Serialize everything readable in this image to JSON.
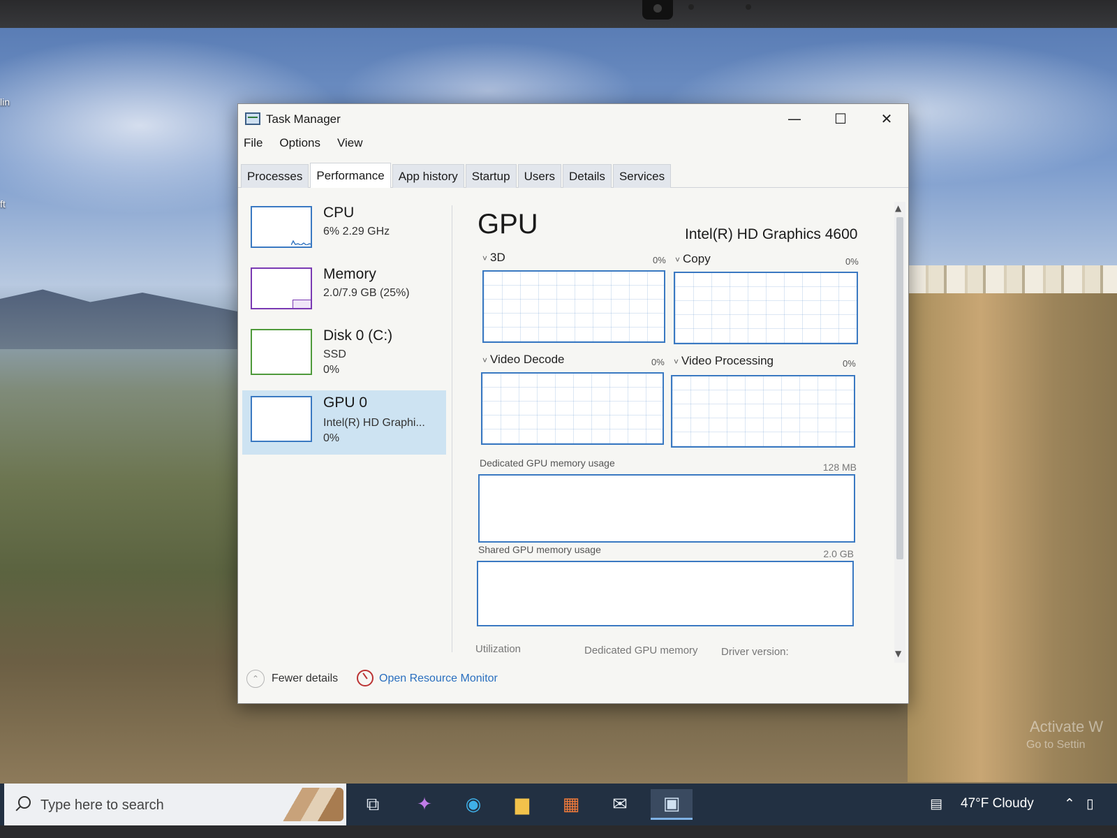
{
  "window": {
    "title": "Task Manager",
    "controls": {
      "minimize": "—",
      "maximize": "☐",
      "close": "✕"
    }
  },
  "menu": [
    "File",
    "Options",
    "View"
  ],
  "tabs": [
    "Processes",
    "Performance",
    "App history",
    "Startup",
    "Users",
    "Details",
    "Services"
  ],
  "active_tab": "Performance",
  "sidebar": [
    {
      "title": "CPU",
      "line1": "6% 2.29 GHz",
      "line2": ""
    },
    {
      "title": "Memory",
      "line1": "2.0/7.9 GB (25%)",
      "line2": ""
    },
    {
      "title": "Disk 0 (C:)",
      "line1": "SSD",
      "line2": "0%"
    },
    {
      "title": "GPU 0",
      "line1": "Intel(R) HD Graphi...",
      "line2": "0%"
    }
  ],
  "gpu": {
    "heading": "GPU",
    "name": "Intel(R) HD Graphics 4600",
    "engines": [
      {
        "label": "3D",
        "percent": "0%"
      },
      {
        "label": "Copy",
        "percent": "0%"
      },
      {
        "label": "Video Decode",
        "percent": "0%"
      },
      {
        "label": "Video Processing",
        "percent": "0%"
      }
    ],
    "dedicated_label": "Dedicated GPU memory usage",
    "dedicated_value": "128 MB",
    "shared_label": "Shared GPU memory usage",
    "shared_value": "2.0 GB",
    "footer": [
      "Utilization",
      "Dedicated GPU memory",
      "Driver version:"
    ]
  },
  "bottom": {
    "fewer_details": "Fewer details",
    "resource_monitor": "Open Resource Monitor"
  },
  "taskbar": {
    "search_placeholder": "Type here to search",
    "weather": "47°F  Cloudy"
  },
  "watermark": [
    "Activate W",
    "Go to Settin"
  ],
  "desktop_labels": [
    "lin",
    "ft"
  ],
  "colors": {
    "cpu_accent": "#3a79c2",
    "memory_accent": "#7a3ab3",
    "disk_accent": "#4f9a3b",
    "gpu_accent": "#3a79c2",
    "selected_bg": "#cde3f2",
    "link": "#2a6fbf"
  }
}
